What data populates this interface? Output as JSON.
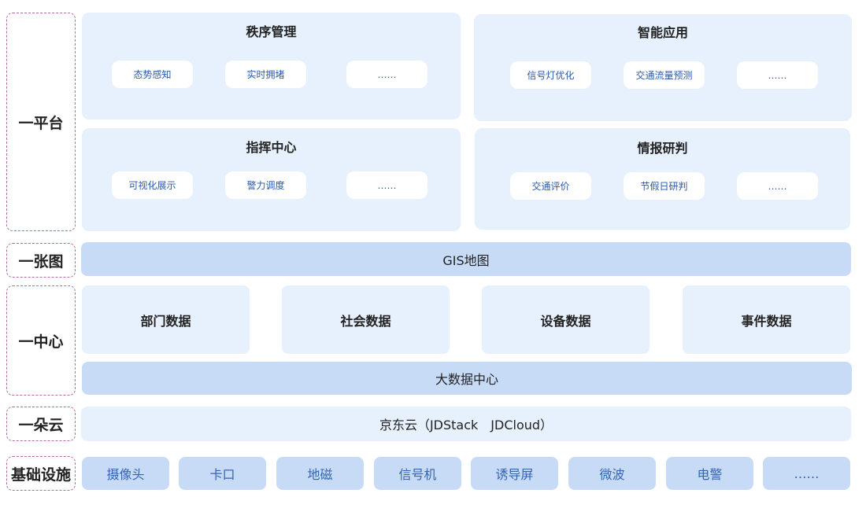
{
  "layers": {
    "platform": "一平台",
    "map": "一张图",
    "center": "一中心",
    "cloud": "一朵云",
    "infra": "基础设施"
  },
  "platform": {
    "order_mgmt": {
      "title": "秩序管理",
      "chips": [
        "态势感知",
        "实时拥堵",
        "……"
      ]
    },
    "smart_app": {
      "title": "智能应用",
      "chips": [
        "信号灯优化",
        "交通流量预测",
        "……"
      ]
    },
    "command": {
      "title": "指挥中心",
      "chips": [
        "可视化展示",
        "警力调度",
        "……"
      ]
    },
    "intel": {
      "title": "情报研判",
      "chips": [
        "交通评价",
        "节假日研判",
        "……"
      ]
    }
  },
  "map_bar": "GIS地图",
  "data_boxes": [
    "部门数据",
    "社会数据",
    "设备数据",
    "事件数据"
  ],
  "bigdata_bar": "大数据中心",
  "cloud_bar": "京东云（JDStack　JDCloud）",
  "infra_items": [
    "摄像头",
    "卡口",
    "地磁",
    "信号机",
    "诱导屏",
    "微波",
    "电警",
    "……"
  ],
  "colors": {
    "dashed_border": "#b06aa4",
    "panel_bg": "#e7f0fd",
    "bar_strong_bg": "#c7dbf7",
    "chip_text": "#2a5aa8"
  }
}
